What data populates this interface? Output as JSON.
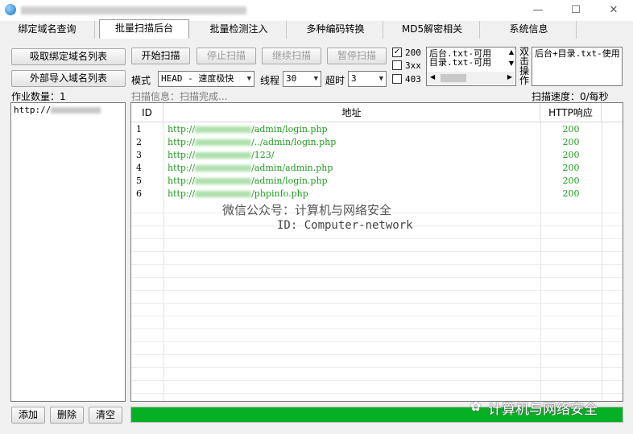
{
  "window": {
    "minimize": "—",
    "maximize": "☐",
    "close": "✕"
  },
  "tabs": [
    "绑定域名查询",
    "批量扫描后台",
    "批量检测注入",
    "多种编码转换",
    "MD5解密相关",
    "系统信息"
  ],
  "toolbar": {
    "fetch_domains": "吸取绑定域名列表",
    "import_domains": "外部导入域名列表",
    "start_scan": "开始扫描",
    "stop_scan": "停止扫描",
    "continue_scan": "继续扫描",
    "pause_scan": "暂停扫描",
    "mode_label": "模式",
    "mode_value": "HEAD - 速度极快",
    "threads_label": "线程",
    "threads_value": "30",
    "timeout_label": "超时",
    "timeout_value": "3"
  },
  "filters": [
    {
      "label": "200",
      "checked": true
    },
    {
      "label": "3xx",
      "checked": false
    },
    {
      "label": "403",
      "checked": false
    }
  ],
  "dict_list": [
    "后台.txt-可用",
    "目录.txt-可用"
  ],
  "dict_hint": "双击操作",
  "dict_selected": "后台+目录.txt-使用",
  "status": {
    "job_count": "作业数量：1",
    "scan_info": "扫描信息：扫描完成...",
    "scan_speed": "扫描速度：0/每秒"
  },
  "domain_list": [
    "http://"
  ],
  "bottom_buttons": {
    "add": "添加",
    "delete": "删除",
    "clear": "清空"
  },
  "table": {
    "headers": [
      "ID",
      "地址",
      "HTTP响应"
    ],
    "rows": [
      {
        "id": "1",
        "prefix": "http://",
        "path": "/admin/login.php",
        "code": "200"
      },
      {
        "id": "2",
        "prefix": "http://",
        "path": "/../admin/login.php",
        "code": "200"
      },
      {
        "id": "3",
        "prefix": "http://",
        "path": "/123/",
        "code": "200"
      },
      {
        "id": "4",
        "prefix": "http://",
        "path": "/admin/admin.php",
        "code": "200"
      },
      {
        "id": "5",
        "prefix": "http://",
        "path": "/admin/login.php",
        "code": "200"
      },
      {
        "id": "6",
        "prefix": "http://",
        "path": "/phpinfo.php",
        "code": "200"
      }
    ]
  },
  "watermark": {
    "line1": "微信公众号：计算机与网络安全",
    "line2": "ID: Computer-network"
  },
  "footer_watermark": "计算机与网络安全",
  "progress": 1.0,
  "colors": {
    "progress": "#06b025",
    "link": "#1f9b1f"
  }
}
